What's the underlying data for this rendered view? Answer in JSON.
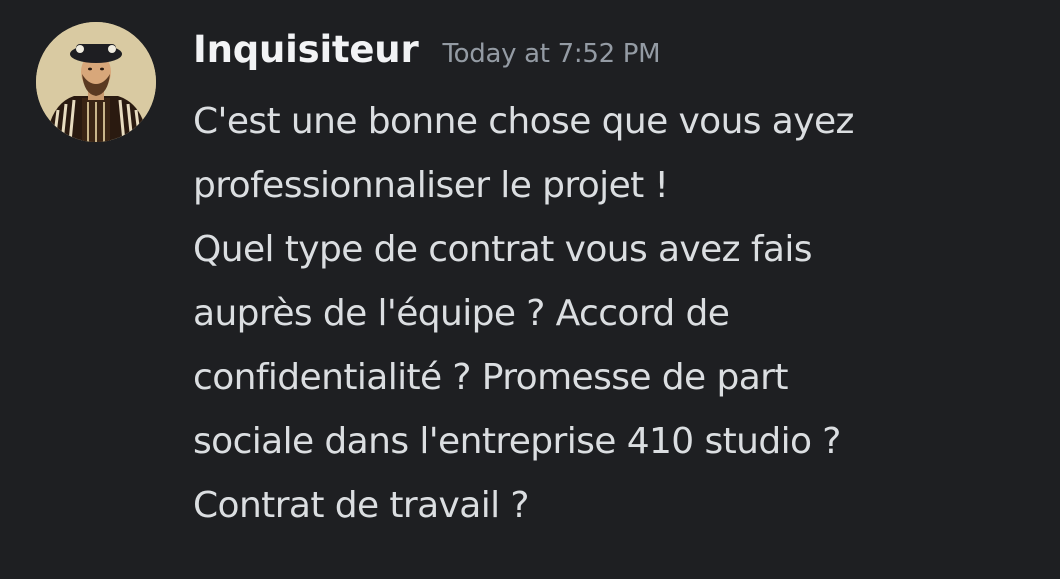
{
  "message": {
    "author": "Inquisiteur",
    "timestamp": "Today at 7:52 PM",
    "lines": [
      "C'est une bonne chose que vous ayez",
      "professionnaliser le projet !",
      "Quel type de contrat vous avez fais",
      "auprès de l'équipe ? Accord de",
      "confidentialité ? Promesse de part",
      "sociale dans l'entreprise 410 studio ?",
      "Contrat de travail ?"
    ]
  },
  "colors": {
    "background": "#1e1f22",
    "username": "#f2f3f5",
    "timestamp": "#949ba4",
    "text": "#dbdee1"
  }
}
